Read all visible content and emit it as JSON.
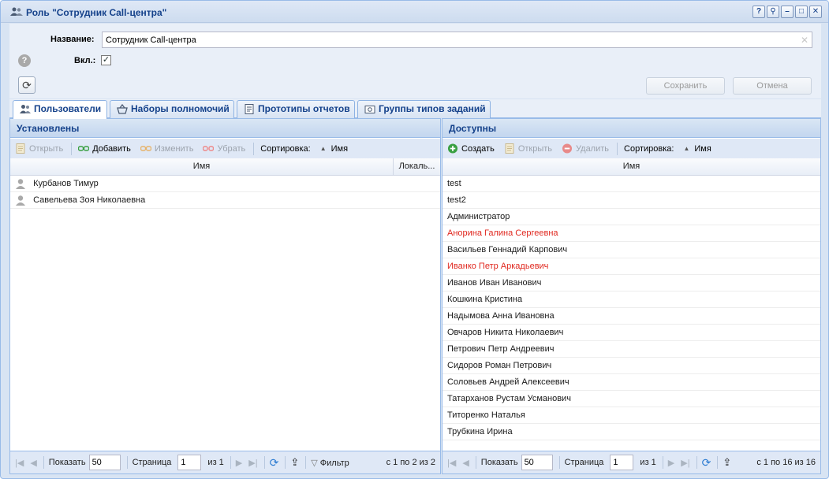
{
  "window": {
    "title": "Роль \"Сотрудник Call-центра\"",
    "tools": [
      "?",
      "⚲",
      "–",
      "□",
      "✕"
    ]
  },
  "form": {
    "name_label": "Название:",
    "name_value": "Сотрудник Call-центра",
    "enabled_label": "Вкл.:",
    "enabled_checked": "✓",
    "help_glyph": "?",
    "refresh_glyph": "⟳",
    "save_label": "Сохранить",
    "cancel_label": "Отмена"
  },
  "tabs": [
    {
      "label": "Пользователи",
      "active": true
    },
    {
      "label": "Наборы полномочий"
    },
    {
      "label": "Прототипы отчетов"
    },
    {
      "label": "Группы типов заданий"
    }
  ],
  "left": {
    "title": "Установлены",
    "toolbar": {
      "open": "Открыть",
      "add": "Добавить",
      "edit": "Изменить",
      "remove": "Убрать",
      "sort_label": "Сортировка:",
      "sort_field": "Имя"
    },
    "columns": [
      "Имя",
      "Локаль..."
    ],
    "rows": [
      "Курбанов Тимур",
      "Савельева Зоя Николаевна"
    ],
    "pager": {
      "show": "Показать",
      "page_size": "50",
      "page": "Страница",
      "page_value": "1",
      "of": "из 1",
      "filter": "Фильтр",
      "count": "с 1 по 2 из 2"
    }
  },
  "right": {
    "title": "Доступны",
    "toolbar": {
      "create": "Создать",
      "open": "Открыть",
      "delete": "Удалить",
      "sort_label": "Сортировка:",
      "sort_field": "Имя"
    },
    "columns": [
      "Имя"
    ],
    "rows": [
      {
        "name": "test"
      },
      {
        "name": "test2"
      },
      {
        "name": "Администратор"
      },
      {
        "name": "Анорина Галина Сергеевна",
        "red": true
      },
      {
        "name": "Васильев Геннадий Карпович"
      },
      {
        "name": "Иванко Петр Аркадьевич",
        "red": true
      },
      {
        "name": "Иванов Иван Иванович"
      },
      {
        "name": "Кошкина Кристина"
      },
      {
        "name": "Надымова Анна Ивановна"
      },
      {
        "name": "Овчаров Никита Николаевич"
      },
      {
        "name": "Петрович Петр Андреевич"
      },
      {
        "name": "Сидоров Роман Петрович"
      },
      {
        "name": "Соловьев Андрей Алексеевич"
      },
      {
        "name": "Татарханов Рустам Усманович"
      },
      {
        "name": "Титоренко Наталья"
      },
      {
        "name": "Трубкина Ирина"
      }
    ],
    "pager": {
      "show": "Показать",
      "page_size": "50",
      "page": "Страница",
      "page_value": "1",
      "of": "из 1",
      "count": "с 1 по 16 из 16"
    }
  },
  "colors": {
    "accent": "#15428b",
    "red_row": "#e0281f",
    "create_green": "#3aa043",
    "delete_red": "#e06060"
  }
}
